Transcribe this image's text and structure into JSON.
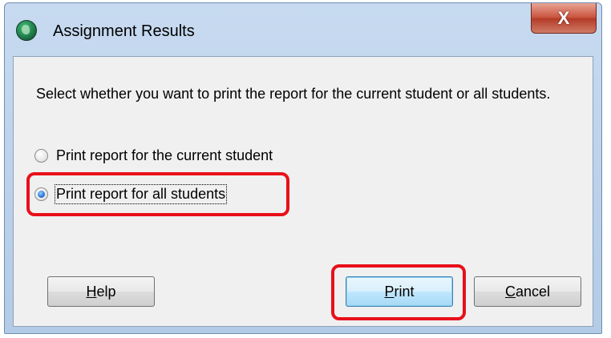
{
  "window": {
    "title": "Assignment Results",
    "close_glyph": "X",
    "icon": "app-globe-icon"
  },
  "dialog": {
    "instruction": "Select whether you want to print the report for the current student or all students.",
    "options": [
      {
        "label": "Print report for the current student",
        "checked": false
      },
      {
        "label": "Print report for all students",
        "checked": true
      }
    ]
  },
  "buttons": {
    "help": {
      "mnemonic": "H",
      "rest": "elp"
    },
    "print": {
      "mnemonic": "P",
      "rest": "rint"
    },
    "cancel": {
      "mnemonic": "C",
      "rest": "ancel"
    }
  },
  "colors": {
    "highlight": "#e8101a",
    "default_button": "#bee6fd"
  }
}
